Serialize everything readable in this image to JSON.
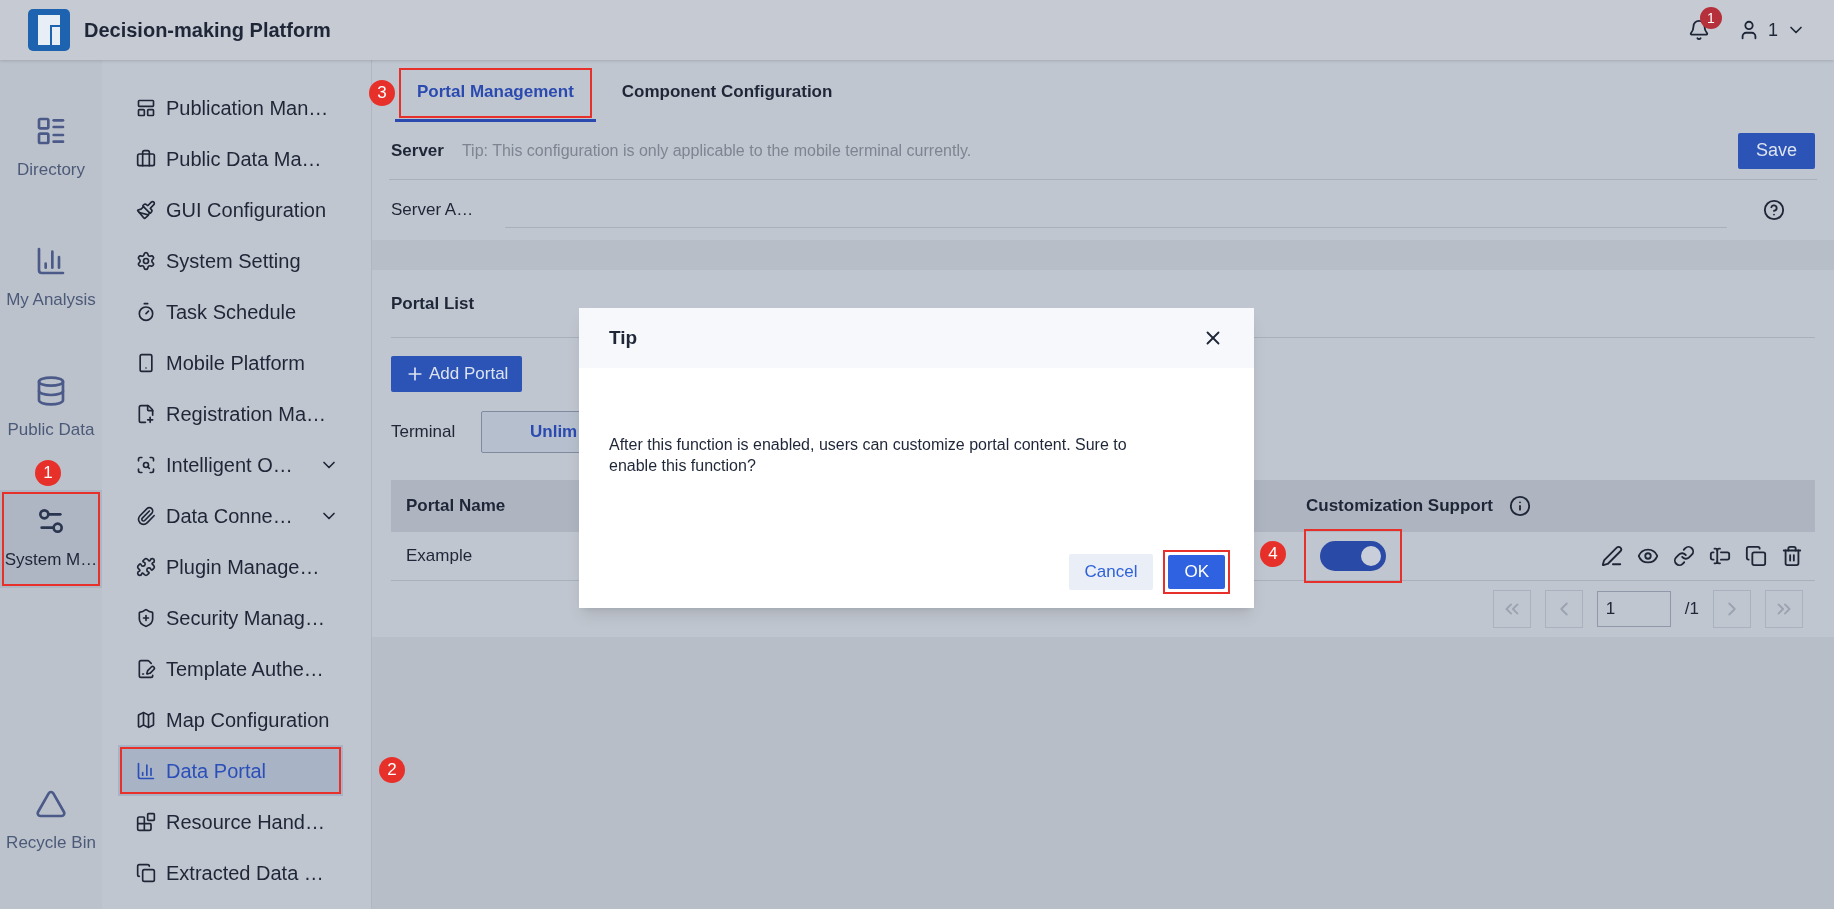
{
  "header": {
    "title": "Decision-making Platform",
    "notifications": "1",
    "user": "1"
  },
  "rail": [
    {
      "label": "Directory",
      "selected": false,
      "highlighted": false
    },
    {
      "label": "My Analysis",
      "selected": false,
      "highlighted": false
    },
    {
      "label": "Public Data",
      "selected": false,
      "highlighted": false
    },
    {
      "label": "System M…",
      "selected": true,
      "highlighted": true,
      "callout": "1"
    },
    {
      "label": "Recycle Bin",
      "selected": false,
      "highlighted": false
    }
  ],
  "sidebar": {
    "items": [
      {
        "label": "Publication Man…",
        "selected": false,
        "expandable": false,
        "highlighted": false
      },
      {
        "label": "Public Data Ma…",
        "selected": false,
        "expandable": false,
        "highlighted": false
      },
      {
        "label": "GUI Configuration",
        "selected": false,
        "expandable": false,
        "highlighted": false
      },
      {
        "label": "System Setting",
        "selected": false,
        "expandable": false,
        "highlighted": false
      },
      {
        "label": "Task Schedule",
        "selected": false,
        "expandable": false,
        "highlighted": false
      },
      {
        "label": "Mobile Platform",
        "selected": false,
        "expandable": false,
        "highlighted": false
      },
      {
        "label": "Registration Ma…",
        "selected": false,
        "expandable": false,
        "highlighted": false
      },
      {
        "label": "Intelligent O…",
        "selected": false,
        "expandable": true,
        "highlighted": false
      },
      {
        "label": "Data Conne…",
        "selected": false,
        "expandable": true,
        "highlighted": false
      },
      {
        "label": "Plugin Manage…",
        "selected": false,
        "expandable": false,
        "highlighted": false
      },
      {
        "label": "Security Manag…",
        "selected": false,
        "expandable": false,
        "highlighted": false
      },
      {
        "label": "Template Authe…",
        "selected": false,
        "expandable": false,
        "highlighted": false
      },
      {
        "label": "Map Configuration",
        "selected": false,
        "expandable": false,
        "highlighted": false
      },
      {
        "label": "Data Portal",
        "selected": true,
        "expandable": false,
        "highlighted": true,
        "callout": "2"
      },
      {
        "label": "Resource Hand…",
        "selected": false,
        "expandable": false,
        "highlighted": false
      },
      {
        "label": "Extracted Data …",
        "selected": false,
        "expandable": false,
        "highlighted": false
      }
    ]
  },
  "tabs": [
    {
      "label": "Portal Management",
      "selected": true,
      "highlighted": true,
      "callout": "3"
    },
    {
      "label": "Component Configuration",
      "selected": false,
      "highlighted": false
    }
  ],
  "server": {
    "title": "Server",
    "tip": "Tip: This configuration is only applicable to the mobile terminal currently.",
    "save": "Save",
    "field_label": "Server A…"
  },
  "portal_list": {
    "title": "Portal List",
    "add_button": "Add Portal",
    "terminal_label": "Terminal",
    "terminal_option": "Unlim",
    "columns": [
      "Portal Name",
      "Customization Support"
    ],
    "rows": [
      {
        "name": "Example",
        "customization": {
          "on": true,
          "highlighted": true,
          "callout": "4"
        }
      }
    ],
    "pagination": {
      "page": "1",
      "total": "/1"
    }
  },
  "dialog": {
    "title": "Tip",
    "message": "After this function is enabled, users can customize portal content. Sure to enable this function?",
    "cancel": "Cancel",
    "ok": "OK",
    "ok_highlighted": true
  }
}
